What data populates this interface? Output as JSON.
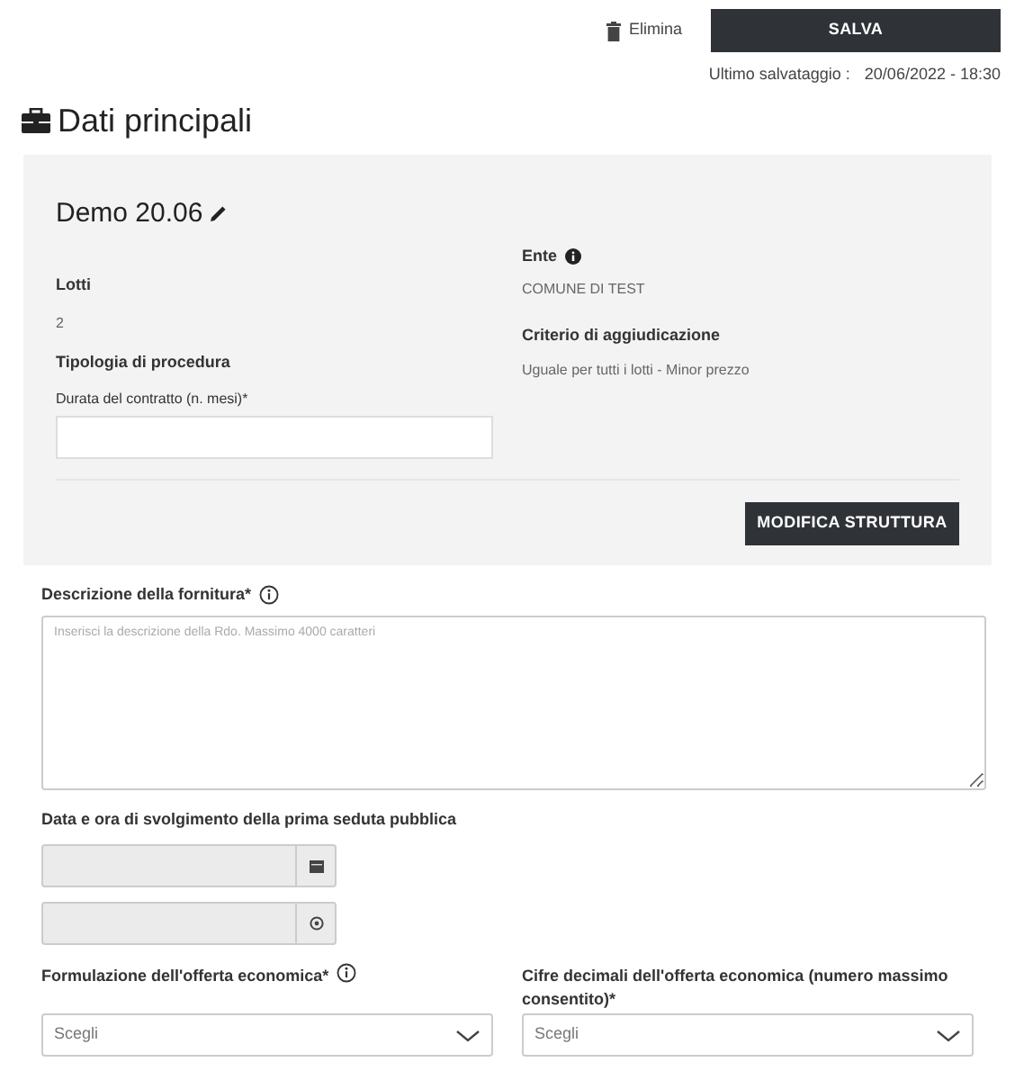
{
  "toolbar": {
    "delete_label": "Elimina",
    "save_label": "SALVA",
    "last_saved_label": "Ultimo salvataggio :",
    "last_saved_value": "20/06/2022 - 18:30"
  },
  "section_title": "Dati principali",
  "summary": {
    "name": "Demo 20.06",
    "left": [
      {
        "label": "Lotti",
        "value": "2"
      },
      {
        "label": "Tipologia di procedura"
      }
    ],
    "duration": {
      "label": "Durata del contratto (n. mesi)*"
    },
    "right": [
      {
        "label": "Ente",
        "value": "COMUNE DI TEST",
        "info": true
      },
      {
        "label": "Criterio di aggiudicazione",
        "value": "Uguale per tutti i lotti - Minor prezzo",
        "info": false
      }
    ],
    "button": "MODIFICA STRUTTURA"
  },
  "description": {
    "label": "Descrizione della fornitura*",
    "placeholder": "Inserisci la descrizione della Rdo. Massimo 4000 caratteri"
  },
  "session": {
    "label": "Data e ora di svolgimento della prima seduta pubblica",
    "fields": [
      {
        "kind": "date",
        "disabled": true
      },
      {
        "kind": "time",
        "disabled": true
      }
    ]
  },
  "selects": [
    {
      "label": "Formulazione dell'offerta economica*",
      "info": true,
      "placeholder": "Scegli"
    },
    {
      "label": "Cifre decimali dell'offerta economica (numero massimo consentito)*",
      "info": false,
      "placeholder": "Scegli"
    }
  ]
}
